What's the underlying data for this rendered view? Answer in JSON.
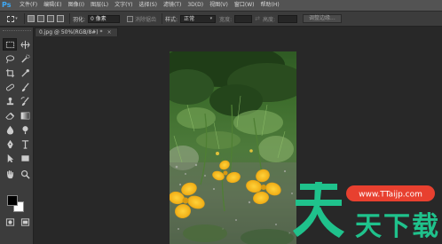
{
  "app": {
    "logo": "Ps",
    "menu": [
      "文件(F)",
      "编辑(E)",
      "图像(I)",
      "图层(L)",
      "文字(Y)",
      "选择(S)",
      "滤镜(T)",
      "3D(D)",
      "视图(V)",
      "窗口(W)",
      "帮助(H)"
    ]
  },
  "options": {
    "feather_label": "羽化:",
    "feather_value": "0 像素",
    "antialias_label": "消除锯齿",
    "style_label": "样式:",
    "style_value": "正常",
    "width_label": "宽度:",
    "height_label": "高度:",
    "refine_label": "调整边缘..."
  },
  "document": {
    "tab_title": "0.jpg @ 50%(RGB/8#) *",
    "close": "×"
  },
  "watermark": {
    "chars": [
      "天",
      "天",
      "下",
      "载"
    ],
    "url": "www.TTaijp.com"
  },
  "colors": {
    "foreground": "#000000",
    "background": "#ffffff",
    "watermark_green": "#1fc28c",
    "watermark_red": "#e8402f"
  },
  "tool_icons": [
    "marquee-tool",
    "move-tool",
    "lasso-tool",
    "quick-select-tool",
    "crop-tool",
    "eyedropper-tool",
    "healing-brush-tool",
    "brush-tool",
    "clone-stamp-tool",
    "history-brush-tool",
    "eraser-tool",
    "gradient-tool",
    "blur-tool",
    "dodge-tool",
    "pen-tool",
    "type-tool",
    "path-select-tool",
    "shape-tool",
    "hand-tool",
    "zoom-tool"
  ]
}
